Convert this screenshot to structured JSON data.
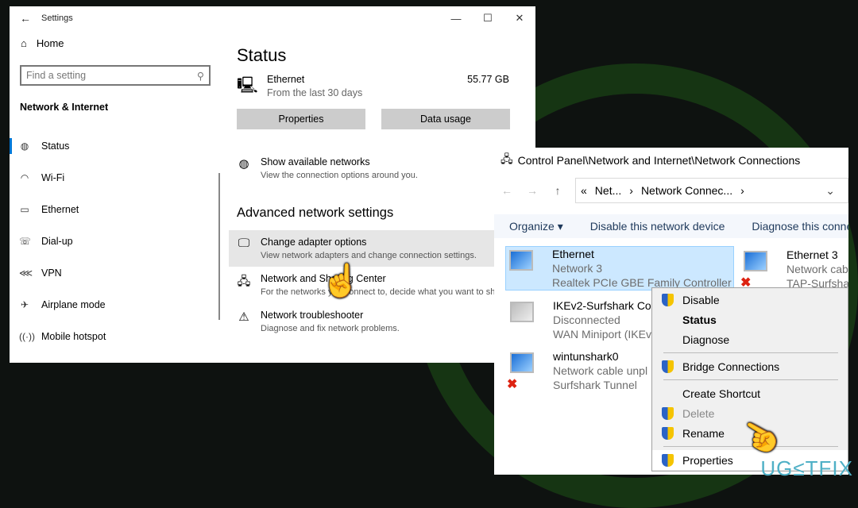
{
  "settings": {
    "title": "Settings",
    "back_icon": "arrow-left",
    "controls": [
      "—",
      "☐",
      "✕"
    ],
    "home": "Home",
    "search_placeholder": "Find a setting",
    "section": "Network & Internet",
    "nav": [
      {
        "label": "Status",
        "icon": "globe"
      },
      {
        "label": "Wi-Fi",
        "icon": "wifi"
      },
      {
        "label": "Ethernet",
        "icon": "ethernet"
      },
      {
        "label": "Dial-up",
        "icon": "dialup"
      },
      {
        "label": "VPN",
        "icon": "vpn"
      },
      {
        "label": "Airplane mode",
        "icon": "airplane"
      },
      {
        "label": "Mobile hotspot",
        "icon": "hotspot"
      }
    ],
    "main": {
      "title": "Status",
      "eth_name": "Ethernet",
      "eth_sub": "From the last 30 days",
      "eth_size": "55.77 GB",
      "btn_properties": "Properties",
      "btn_data": "Data usage",
      "show_networks": "Show available networks",
      "show_networks_desc": "View the connection options around you.",
      "advanced": "Advanced network settings",
      "adapter": "Change adapter options",
      "adapter_desc": "View network adapters and change connection settings.",
      "sharing": "Network and Sharing Center",
      "sharing_desc": "For the networks you connect to, decide what you want to share.",
      "troubleshooter": "Network troubleshooter",
      "troubleshooter_desc": "Diagnose and fix network problems."
    }
  },
  "cp": {
    "title": "Control Panel\\Network and Internet\\Network Connections",
    "crumbs": [
      "«",
      "Net...",
      "›",
      "Network Connec...",
      "›"
    ],
    "commands": [
      "Organize ▾",
      "Disable this network device",
      "Diagnose this conne"
    ],
    "connections": [
      {
        "name": "Ethernet",
        "status": "Network 3",
        "device": "Realtek PCIe GBE Family Controller"
      },
      {
        "name": "Ethernet 3",
        "status": "Network cab",
        "device": "TAP-Surfsha"
      },
      {
        "name": "IKEv2-Surfshark Con",
        "status": "Disconnected",
        "device": "WAN Miniport (IKEv"
      },
      {
        "name": "wintunshark0",
        "status": "Network cable unpl",
        "device": "Surfshark Tunnel"
      }
    ]
  },
  "menu": {
    "items": [
      "Disable",
      "Status",
      "Diagnose",
      "Bridge Connections",
      "Create Shortcut",
      "Delete",
      "Rename",
      "Properties"
    ]
  },
  "watermark": "UG≤TFIX"
}
